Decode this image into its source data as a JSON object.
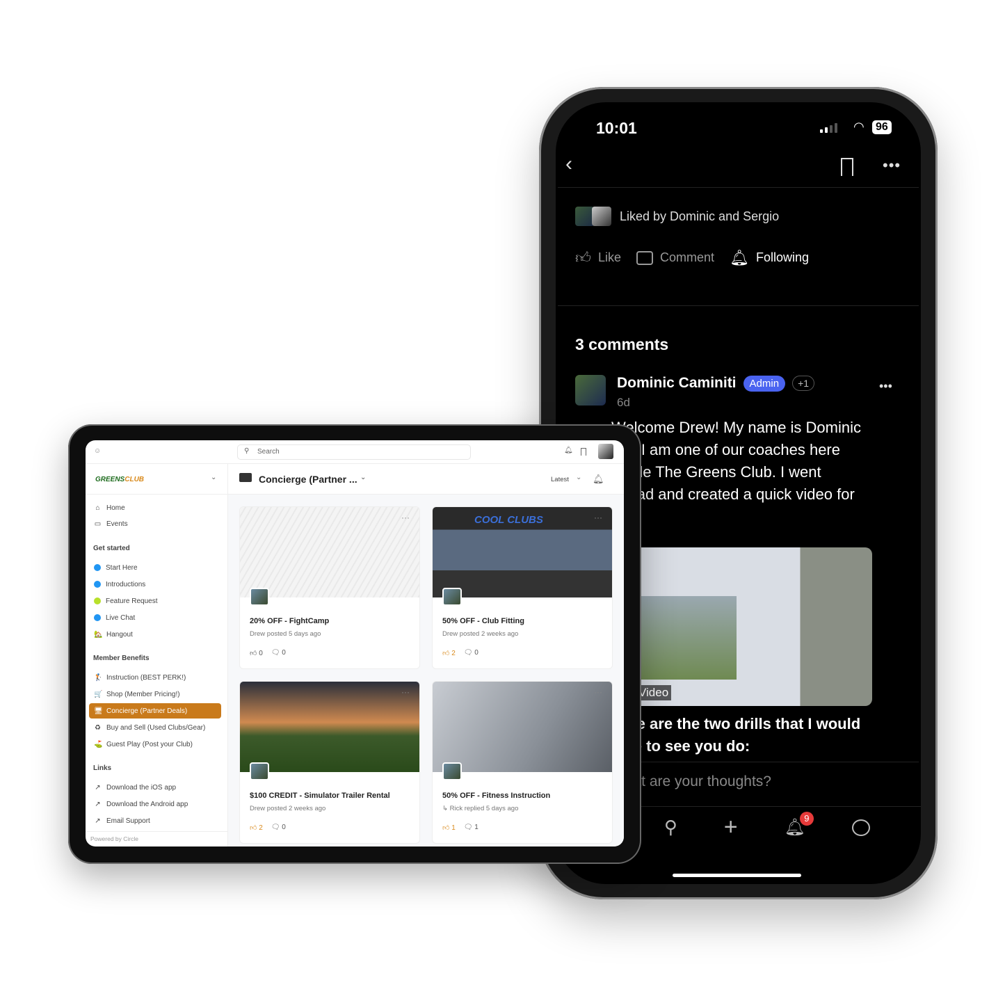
{
  "phone": {
    "status": {
      "time": "10:01",
      "battery": "96"
    },
    "liked_by": "Liked by Dominic and Sergio",
    "actions": [
      {
        "label": "Like",
        "icon": "thumbs-up-icon"
      },
      {
        "label": "Comment",
        "icon": "comment-icon"
      },
      {
        "label": "Following",
        "icon": "bell-icon"
      }
    ],
    "comments_heading": "3 comments",
    "comment": {
      "author": "Dominic Caminiti",
      "badge": "Admin",
      "extra": "+1",
      "age": "6d",
      "text": "Welcome Drew!  My name is Dominic and I am one of our coaches here inside The Greens Club.  I went ahead and created a quick video for you.",
      "video_label": "Video",
      "text2": "Here are the two drills that I would love to see you do:"
    },
    "input_placeholder": "What are your thoughts?",
    "nav": {
      "notification_count": "9"
    },
    "colors": {
      "admin_badge": "#4a63f0",
      "notif_badge": "#e63a3a"
    }
  },
  "tablet": {
    "search_placeholder": "Search",
    "brand": {
      "a": "GREENS",
      "b": "CLUB"
    },
    "sidebar": {
      "top": [
        {
          "label": "Home",
          "icon": "⌂"
        },
        {
          "label": "Events",
          "icon": "▭"
        }
      ],
      "groups": [
        {
          "heading": "Get started",
          "items": [
            {
              "label": "Start Here",
              "dot": "#2196f3"
            },
            {
              "label": "Introductions",
              "dot": "#2196f3"
            },
            {
              "label": "Feature Request",
              "dot": "#b8e02a"
            },
            {
              "label": "Live Chat",
              "dot": "#2196f3"
            },
            {
              "label": "Hangout",
              "icon": "🏡"
            }
          ]
        },
        {
          "heading": "Member Benefits",
          "items": [
            {
              "label": "Instruction (BEST PERK!)",
              "icon": "🏌"
            },
            {
              "label": "Shop (Member Pricing!)",
              "icon": "🛒"
            },
            {
              "label": "Concierge (Partner Deals)",
              "icon": "🖥",
              "selected": true
            },
            {
              "label": "Buy and Sell (Used Clubs/Gear)",
              "icon": "♻"
            },
            {
              "label": "Guest Play (Post your Club)",
              "icon": "⛳"
            }
          ]
        },
        {
          "heading": "Links",
          "items": [
            {
              "label": "Download the iOS app",
              "icon": "↗"
            },
            {
              "label": "Download the Android app",
              "icon": "↗"
            },
            {
              "label": "Email Support",
              "icon": "↗"
            }
          ]
        }
      ],
      "footer": "Powered by Circle"
    },
    "space_title": "Concierge (Partner ...",
    "sort": "Latest",
    "accent": "#c97a1b",
    "posts": [
      {
        "title": "20% OFF - FightCamp",
        "meta": "Drew posted 5 days ago",
        "likes": "0",
        "comments": "0",
        "liked": false
      },
      {
        "title": "50% OFF - Club Fitting",
        "meta": "Drew posted 2 weeks ago",
        "likes": "2",
        "comments": "0",
        "liked": true,
        "image_text": "COOL CLUBS"
      },
      {
        "title": "$100 CREDIT - Simulator Trailer Rental",
        "meta": "Drew posted 2 weeks ago",
        "likes": "2",
        "comments": "0",
        "liked": true
      },
      {
        "title": "50% OFF - Fitness Instruction",
        "meta": "↳ Rick replied 5 days ago",
        "likes": "1",
        "comments": "1",
        "liked": true
      }
    ]
  }
}
